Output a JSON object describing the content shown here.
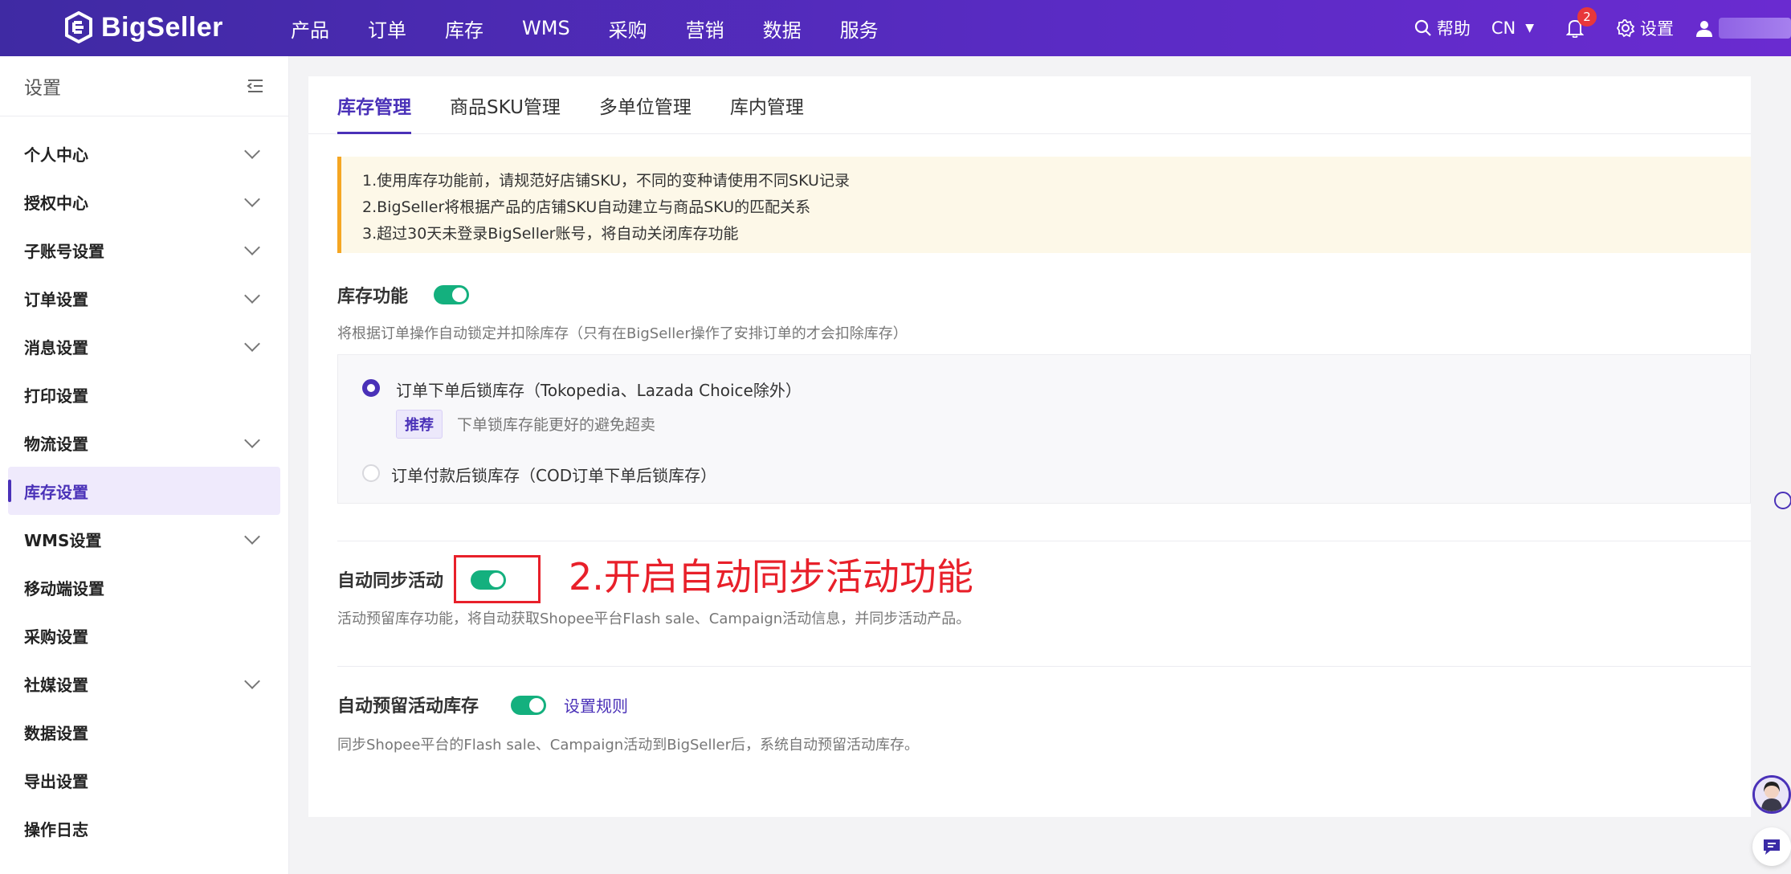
{
  "brand": {
    "name": "BigSeller",
    "accent": "#4a31b8",
    "toggle_on": "#14b07e",
    "annotation_color": "#e8202a"
  },
  "topnav": {
    "items": [
      "产品",
      "订单",
      "库存",
      "WMS",
      "采购",
      "营销",
      "数据",
      "服务"
    ],
    "help": "帮助",
    "language": "CN",
    "notification_count": "2",
    "settings": "设置"
  },
  "sidebar": {
    "title": "设置",
    "items": [
      {
        "label": "个人中心",
        "expandable": true
      },
      {
        "label": "授权中心",
        "expandable": true
      },
      {
        "label": "子账号设置",
        "expandable": true
      },
      {
        "label": "订单设置",
        "expandable": true
      },
      {
        "label": "消息设置",
        "expandable": true
      },
      {
        "label": "打印设置",
        "expandable": false
      },
      {
        "label": "物流设置",
        "expandable": true
      },
      {
        "label": "库存设置",
        "expandable": false,
        "active": true
      },
      {
        "label": "WMS设置",
        "expandable": true
      },
      {
        "label": "移动端设置",
        "expandable": false
      },
      {
        "label": "采购设置",
        "expandable": false
      },
      {
        "label": "社媒设置",
        "expandable": true
      },
      {
        "label": "数据设置",
        "expandable": false
      },
      {
        "label": "导出设置",
        "expandable": false
      },
      {
        "label": "操作日志",
        "expandable": false
      }
    ]
  },
  "tabs": [
    "库存管理",
    "商品SKU管理",
    "多单位管理",
    "库内管理"
  ],
  "notice": [
    "1.使用库存功能前，请规范好店铺SKU，不同的变种请使用不同SKU记录",
    "2.BigSeller将根据产品的店铺SKU自动建立与商品SKU的匹配关系",
    "3.超过30天未登录BigSeller账号，将自动关闭库存功能"
  ],
  "inventory": {
    "title": "库存功能",
    "enabled": true,
    "desc": "将根据订单操作自动锁定并扣除库存（只有在BigSeller操作了安排订单的才会扣除库存）",
    "option1": "订单下单后锁库存（Tokopedia、Lazada Choice除外）",
    "option1_tag": "推荐",
    "option1_hint": "下单锁库存能更好的避免超卖",
    "option2": "订单付款后锁库存（COD订单下单后锁库存）"
  },
  "auto_sync": {
    "title": "自动同步活动",
    "enabled": true,
    "desc": "活动预留库存功能，将自动获取Shopee平台Flash sale、Campaign活动信息，并同步活动产品。",
    "annotation": "2.开启自动同步活动功能"
  },
  "auto_reserve": {
    "title": "自动预留活动库存",
    "enabled": true,
    "link": "设置规则",
    "desc": "同步Shopee平台的Flash sale、Campaign活动到BigSeller后，系统自动预留活动库存。"
  }
}
